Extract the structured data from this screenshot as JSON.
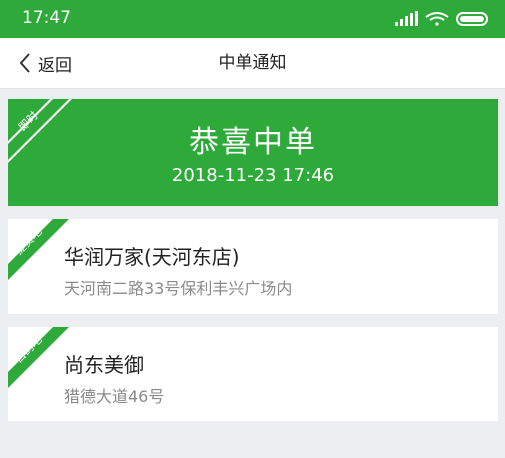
{
  "status_bar": {
    "time": "17:47",
    "accent": "#2eaa3a"
  },
  "nav": {
    "back_label": "返回",
    "title": "中单通知"
  },
  "banner": {
    "tag": "即时",
    "title": "恭喜中单",
    "datetime": "2018-11-23 17:46"
  },
  "pickup": {
    "tag": "提货地",
    "name": "华润万家(天河东店)",
    "address": "天河南二路33号保利丰兴广场内"
  },
  "destination": {
    "tag": "目的地",
    "name": "尚东美御",
    "address": "猎德大道46号"
  }
}
